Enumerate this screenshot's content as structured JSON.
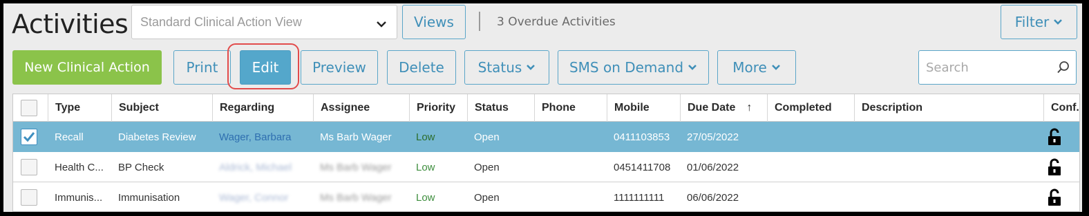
{
  "header": {
    "title": "Activities",
    "view_select": "Standard Clinical Action View",
    "views_label": "Views",
    "overdue_text": "3 Overdue Activities",
    "filter_label": "Filter"
  },
  "toolbar": {
    "new_label": "New Clinical Action",
    "print_label": "Print",
    "edit_label": "Edit",
    "preview_label": "Preview",
    "delete_label": "Delete",
    "status_label": "Status",
    "sms_label": "SMS on Demand",
    "more_label": "More",
    "search_placeholder": "Search"
  },
  "table": {
    "columns": [
      "Type",
      "Subject",
      "Regarding",
      "Assignee",
      "Priority",
      "Status",
      "Phone",
      "Mobile",
      "Due Date",
      "Completed",
      "Description",
      "Conf."
    ],
    "sort_indicator": "↑",
    "rows": [
      {
        "selected": true,
        "type": "Recall",
        "subject": "Diabetes Review",
        "regarding": "Wager, Barbara",
        "assignee": "Ms Barb Wager",
        "priority": "Low",
        "status": "Open",
        "phone": "",
        "mobile": "0411103853",
        "due": "27/05/2022",
        "completed": "",
        "description": ""
      },
      {
        "selected": false,
        "type": "Health C...",
        "subject": "BP Check",
        "regarding": "Aldrick, Michael",
        "assignee": "Ms Barb Wager",
        "priority": "Low",
        "status": "Open",
        "phone": "",
        "mobile": "0451411708",
        "due": "01/06/2022",
        "completed": "",
        "description": ""
      },
      {
        "selected": false,
        "type": "Immunis...",
        "subject": "Immunisation",
        "regarding": "Wager, Connor",
        "assignee": "Ms Barb Wager",
        "priority": "Low",
        "status": "Open",
        "phone": "",
        "mobile": "1111111111",
        "due": "06/06/2022",
        "completed": "",
        "description": ""
      }
    ]
  },
  "colors": {
    "accent": "#54a7cb",
    "primary_green": "#8bc34a",
    "selected_row": "#76b7d3",
    "highlight_ring": "#e24b4b"
  },
  "icons": [
    "chevron-down-icon",
    "search-icon",
    "checkmark-icon",
    "lock-open-icon",
    "sort-up-icon"
  ]
}
